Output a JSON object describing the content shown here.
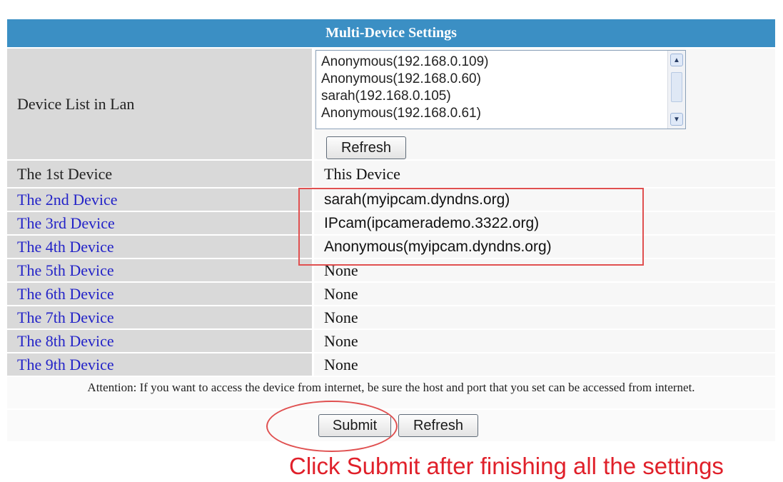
{
  "header": {
    "title": "Multi-Device Settings"
  },
  "device_list": {
    "label": "Device List in Lan",
    "options": [
      "Anonymous(192.168.0.109)",
      "Anonymous(192.168.0.60)",
      "sarah(192.168.0.105)",
      "Anonymous(192.168.0.61)"
    ],
    "refresh_label": "Refresh"
  },
  "devices": [
    {
      "label": "The 1st Device",
      "value": "This Device"
    },
    {
      "label": "The 2nd Device",
      "value": "sarah(myipcam.dyndns.org)"
    },
    {
      "label": "The 3rd Device",
      "value": "IPcam(ipcamerademo.3322.org)"
    },
    {
      "label": "The 4th Device",
      "value": "Anonymous(myipcam.dyndns.org)"
    },
    {
      "label": "The 5th Device",
      "value": "None"
    },
    {
      "label": "The 6th Device",
      "value": "None"
    },
    {
      "label": "The 7th Device",
      "value": "None"
    },
    {
      "label": "The 8th Device",
      "value": "None"
    },
    {
      "label": "The 9th Device",
      "value": "None"
    }
  ],
  "attention": "Attention: If you want to access the device from internet, be sure the host and port that you set can be accessed from internet.",
  "actions": {
    "submit_label": "Submit",
    "refresh_label": "Refresh"
  },
  "annotation": {
    "note": "Click Submit after finishing all the settings",
    "color": "#e0202a"
  },
  "colors": {
    "header_bg": "#3b8fc4",
    "label_bg": "#d9d9d9",
    "link_text": "#2323c8"
  }
}
